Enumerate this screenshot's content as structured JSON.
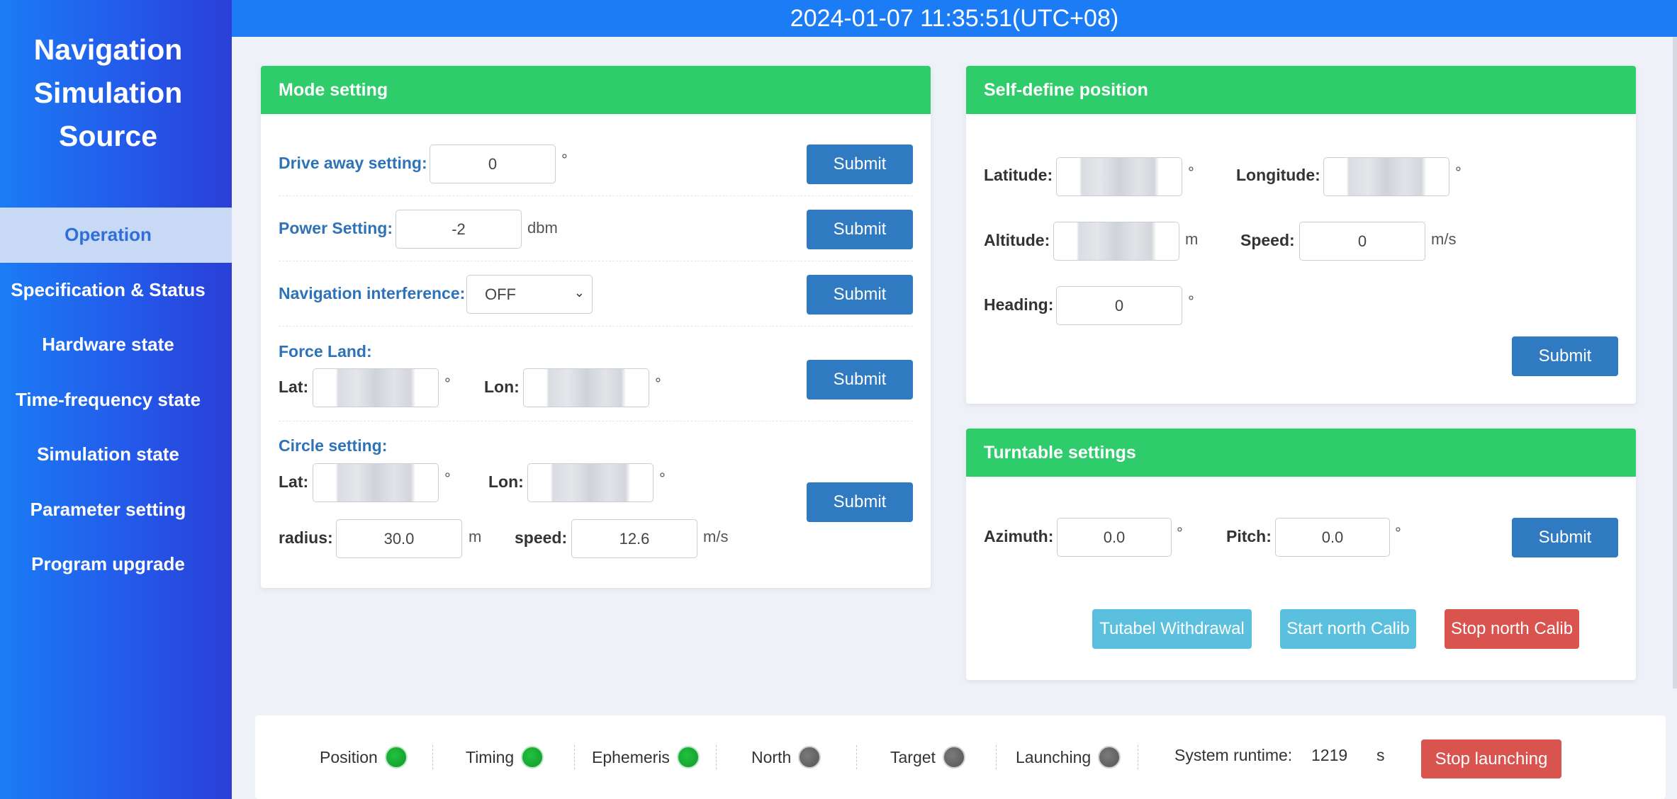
{
  "sidebar": {
    "brand_line1": "Navigation",
    "brand_line2": "Simulation",
    "brand_line3": "Source",
    "items": [
      {
        "label": "Operation"
      },
      {
        "label": "Specification & Status"
      },
      {
        "label": "Hardware state"
      },
      {
        "label": "Time-frequency state"
      },
      {
        "label": "Simulation state"
      },
      {
        "label": "Parameter setting"
      },
      {
        "label": "Program upgrade"
      }
    ]
  },
  "header": {
    "datetime": "2024-01-07 11:35:51(UTC+08)"
  },
  "mode": {
    "title": "Mode setting",
    "drive_away_label": "Drive away setting:",
    "drive_away_value": "0",
    "degree": "°",
    "power_label": "Power Setting:",
    "power_value": "-2",
    "power_unit": "dbm",
    "nav_interference_label": "Navigation interference:",
    "nav_interference_value": "OFF",
    "force_land_label": "Force Land:",
    "lat_label": "Lat:",
    "lon_label": "Lon:",
    "circle_label": "Circle setting:",
    "radius_label": "radius:",
    "radius_value": "30.0",
    "radius_unit": "m",
    "speed_label": "speed:",
    "speed_value": "12.6",
    "speed_unit": "m/s",
    "submit": "Submit"
  },
  "position": {
    "title": "Self-define position",
    "latitude_label": "Latitude:",
    "longitude_label": "Longitude:",
    "altitude_label": "Altitude:",
    "altitude_unit": "m",
    "speed_label": "Speed:",
    "speed_value": "0",
    "speed_unit": "m/s",
    "heading_label": "Heading:",
    "heading_value": "0",
    "degree": "°",
    "submit": "Submit"
  },
  "turntable": {
    "title": "Turntable settings",
    "azimuth_label": "Azimuth:",
    "azimuth_value": "0.0",
    "pitch_label": "Pitch:",
    "pitch_value": "0.0",
    "degree": "°",
    "submit": "Submit",
    "withdrawal": "Tutabel Withdrawal",
    "start_calib": "Start north Calib",
    "stop_calib": "Stop north Calib"
  },
  "status": {
    "position": "Position",
    "timing": "Timing",
    "ephemeris": "Ephemeris",
    "north": "North",
    "target": "Target",
    "launching": "Launching",
    "runtime_label": "System runtime:",
    "runtime_value": "1219",
    "runtime_unit": "s",
    "stop_launching": "Stop launching"
  }
}
